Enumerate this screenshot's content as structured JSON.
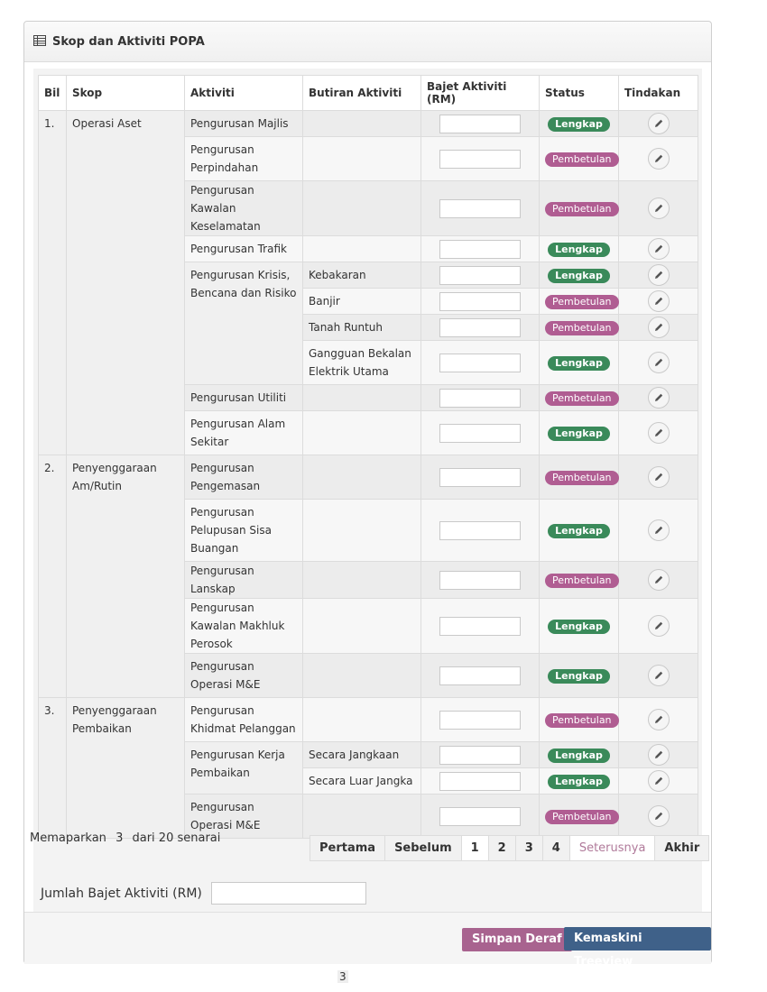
{
  "panel": {
    "title": "Skop dan Aktiviti POPA"
  },
  "table": {
    "headers": [
      "Bil",
      "Skop",
      "Aktiviti",
      "Butiran Aktiviti",
      "Bajet Aktiviti (RM)",
      "Status",
      "Tindakan"
    ],
    "scopes": [
      {
        "bil": "1.",
        "skop": "Operasi Aset"
      },
      {
        "bil": "2.",
        "skop": "Penyenggaraan Am/Rutin"
      },
      {
        "bil": "3.",
        "skop": "Penyenggaraan Pembaikan"
      }
    ],
    "activities": [
      "Pengurusan Majlis",
      "Pengurusan Perpindahan",
      "Pengurusan Kawalan Keselamatan",
      "Pengurusan Trafik",
      "Pengurusan Krisis, Bencana dan Risiko",
      "Pengurusan Utiliti",
      "Pengurusan Alam Sekitar",
      "Pengurusan Pengemasan",
      "Pengurusan Pelupusan Sisa Buangan",
      "Pengurusan Lanskap",
      "Pengurusan Kawalan Makhluk Perosok",
      "Pengurusan Operasi M&E",
      "Pengurusan Khidmat Pelanggan",
      "Pengurusan Kerja Pembaikan",
      "Pengurusan Operasi M&E"
    ],
    "details": {
      "kebakaran": "Kebakaran",
      "banjir": "Banjir",
      "tanah_runtuh": "Tanah Runtuh",
      "gangguan": "Gangguan Bekalan Elektrik Utama",
      "jangkaan": "Secara Jangkaan",
      "luar_jangka": "Secara Luar Jangka"
    },
    "status": {
      "lengkap": "Lengkap",
      "pembetulan": "Pembetulan"
    },
    "status_colors": {
      "lengkap": "#3a8a5a",
      "pembetulan": "#b05d92"
    }
  },
  "paging": {
    "prefix": "Memaparkan",
    "count": "3",
    "suffix": "dari 20 senarai",
    "pages": [
      "Pertama",
      "Sebelum",
      "1",
      "2",
      "3",
      "4",
      "Seterusnya",
      "Akhir"
    ]
  },
  "total": {
    "label": "Jumlah Bajet Aktiviti (RM)"
  },
  "buttons": {
    "draft": "Simpan Deraf",
    "update": "Kemaskini Treeview"
  },
  "page_number": "3"
}
